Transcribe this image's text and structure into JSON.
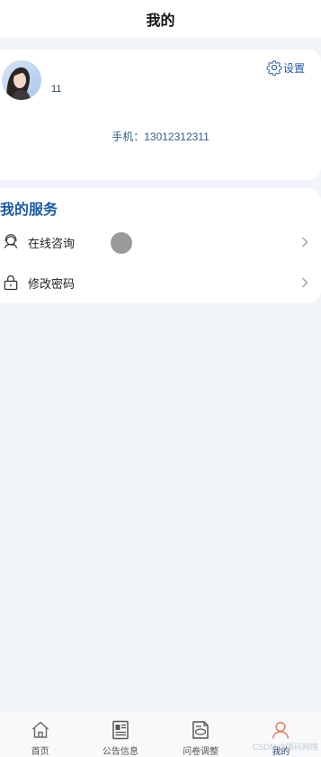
{
  "nav": {
    "title": "我的"
  },
  "profile": {
    "username": "11",
    "settings_label": "设置",
    "phone_text": "手机：13012312311"
  },
  "services": {
    "title": "我的服务",
    "items": [
      {
        "label": "在线咨询",
        "icon": "headset-icon"
      },
      {
        "label": "修改密码",
        "icon": "lock-icon"
      }
    ]
  },
  "tabs": [
    {
      "label": "首页",
      "icon": "home-icon",
      "active": false
    },
    {
      "label": "公告信息",
      "icon": "newspaper-icon",
      "active": false
    },
    {
      "label": "问卷调整",
      "icon": "survey-icon",
      "active": false
    },
    {
      "label": "我的",
      "icon": "user-icon",
      "active": true
    }
  ],
  "watermark": "CSDN @源码网络",
  "colors": {
    "accent": "#1a5aa8",
    "active_tab_icon": "#e0866a",
    "background": "#f1f4f9"
  }
}
